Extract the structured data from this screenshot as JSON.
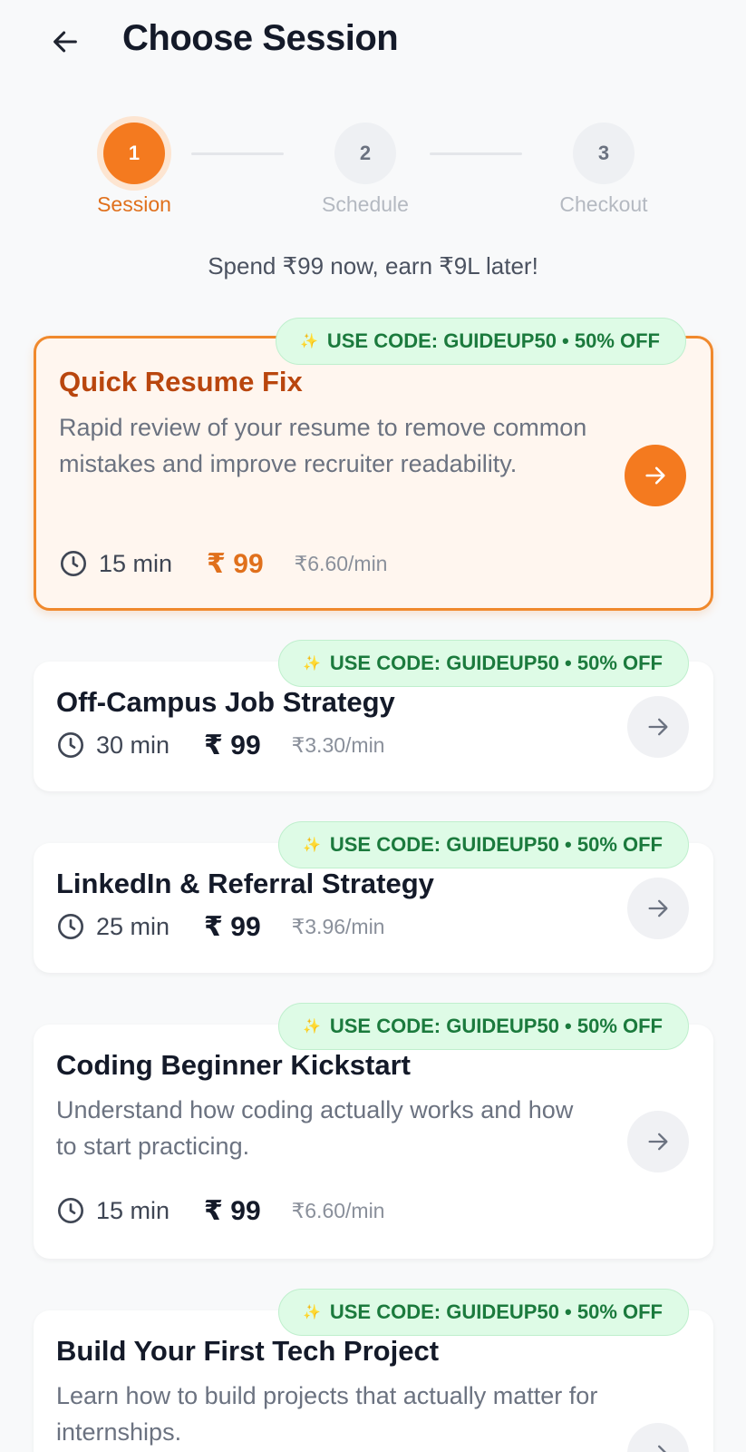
{
  "header": {
    "title": "Choose Session",
    "back_icon": "arrow-left-icon"
  },
  "stepper": {
    "steps": [
      {
        "number": "1",
        "label": "Session",
        "state": "active"
      },
      {
        "number": "2",
        "label": "Schedule",
        "state": "inactive"
      },
      {
        "number": "3",
        "label": "Checkout",
        "state": "inactive"
      }
    ]
  },
  "tagline": "Spend ₹99 now, earn ₹9L later!",
  "colors": {
    "accent": "#f47a1f",
    "promo_bg": "#defbe6",
    "promo_text": "#1b7a3d"
  },
  "sessions": [
    {
      "promo": "USE CODE: GUIDEUP50 • 50% OFF",
      "title": "Quick Resume Fix",
      "description": "Rapid review of your resume to remove common mistakes and improve recruiter readability.",
      "duration": "15 min",
      "price": "₹ 99",
      "rate": "₹6.60/min",
      "selected": true
    },
    {
      "promo": "USE CODE: GUIDEUP50 • 50% OFF",
      "title": "Off-Campus Job Strategy",
      "description": "",
      "duration": "30 min",
      "price": "₹ 99",
      "rate": "₹3.30/min",
      "selected": false
    },
    {
      "promo": "USE CODE: GUIDEUP50 • 50% OFF",
      "title": "LinkedIn & Referral Strategy",
      "description": "",
      "duration": "25 min",
      "price": "₹ 99",
      "rate": "₹3.96/min",
      "selected": false
    },
    {
      "promo": "USE CODE: GUIDEUP50 • 50% OFF",
      "title": "Coding Beginner Kickstart",
      "description": "Understand how coding actually works and how to start practicing.",
      "duration": "15 min",
      "price": "₹ 99",
      "rate": "₹6.60/min",
      "selected": false
    },
    {
      "promo": "USE CODE: GUIDEUP50 • 50% OFF",
      "title": "Build Your First Tech Project",
      "description": "Learn how to build projects that actually matter for internships.",
      "selected": false
    }
  ]
}
